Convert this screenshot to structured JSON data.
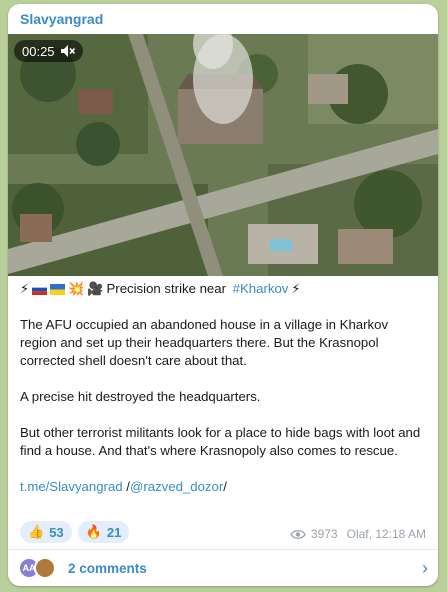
{
  "channel": {
    "name": "Slavyangrad"
  },
  "video": {
    "duration": "00:25",
    "mute_icon": "muted-speaker-icon"
  },
  "post": {
    "headline_prefix_emoji": [
      "⚡",
      "💥",
      "🎥"
    ],
    "headline_text": "Precision strike near ",
    "headline_hashtag": "#Kharkov",
    "headline_suffix_emoji": "⚡",
    "paragraph1": "The AFU occupied an abandoned house in a village in Kharkov region and set up their headquarters there. But the Krasnopol corrected shell doesn't care about that.",
    "paragraph2": "A precise hit destroyed the headquarters.",
    "paragraph3": "But other terrorist militants look for a place to hide bags with loot and find a house. And that's where Krasnopoly also comes to rescue.",
    "link1": "t.me/Slavyangrad",
    "link_sep": " /",
    "link2": "@razved_dozor",
    "link_end": "/"
  },
  "reactions": [
    {
      "emoji": "👍",
      "count": "53"
    },
    {
      "emoji": "🔥",
      "count": "21"
    }
  ],
  "meta": {
    "views": "3973",
    "author_time": "Olaf, 12:18 AM"
  },
  "comments": {
    "avatar1_initials": "AA",
    "label": "2 comments"
  },
  "colors": {
    "accent": "#3a8bc8",
    "background": "#b9cf9a",
    "reaction_bg": "#e3eefa"
  }
}
